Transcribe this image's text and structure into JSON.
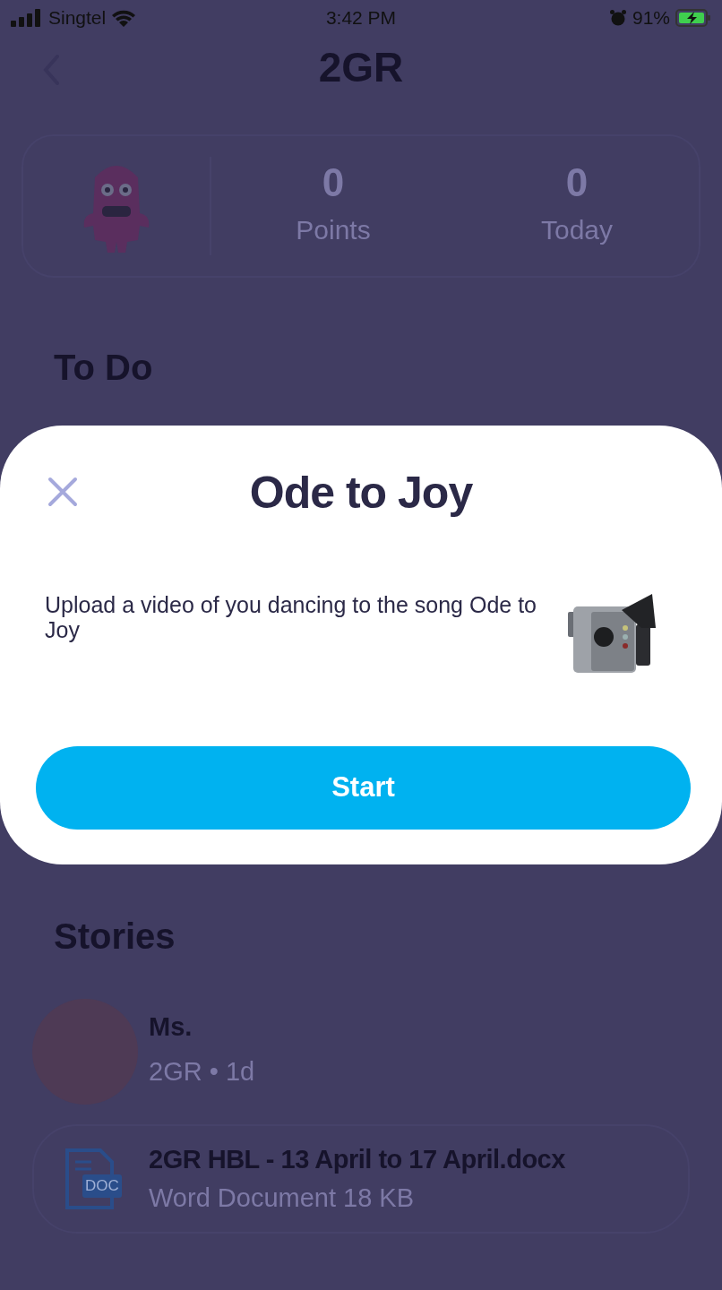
{
  "status_bar": {
    "carrier": "Singtel",
    "time": "3:42 PM",
    "battery": "91%"
  },
  "header": {
    "title": "2GR"
  },
  "stats": [
    {
      "value": "0",
      "label": "Points"
    },
    {
      "value": "0",
      "label": "Today"
    }
  ],
  "todo": {
    "heading": "To Do"
  },
  "modal": {
    "title": "Ode to Joy",
    "description": "Upload a video of you dancing to the song Ode to Joy",
    "button": "Start"
  },
  "stories": {
    "heading": "Stories",
    "post": {
      "author": "Ms.",
      "meta": "2GR • 1d",
      "attachment": {
        "badge": "DOC",
        "name": "2GR HBL - 13 April to 17 April.docx",
        "details": "Word Document 18 KB"
      }
    }
  }
}
